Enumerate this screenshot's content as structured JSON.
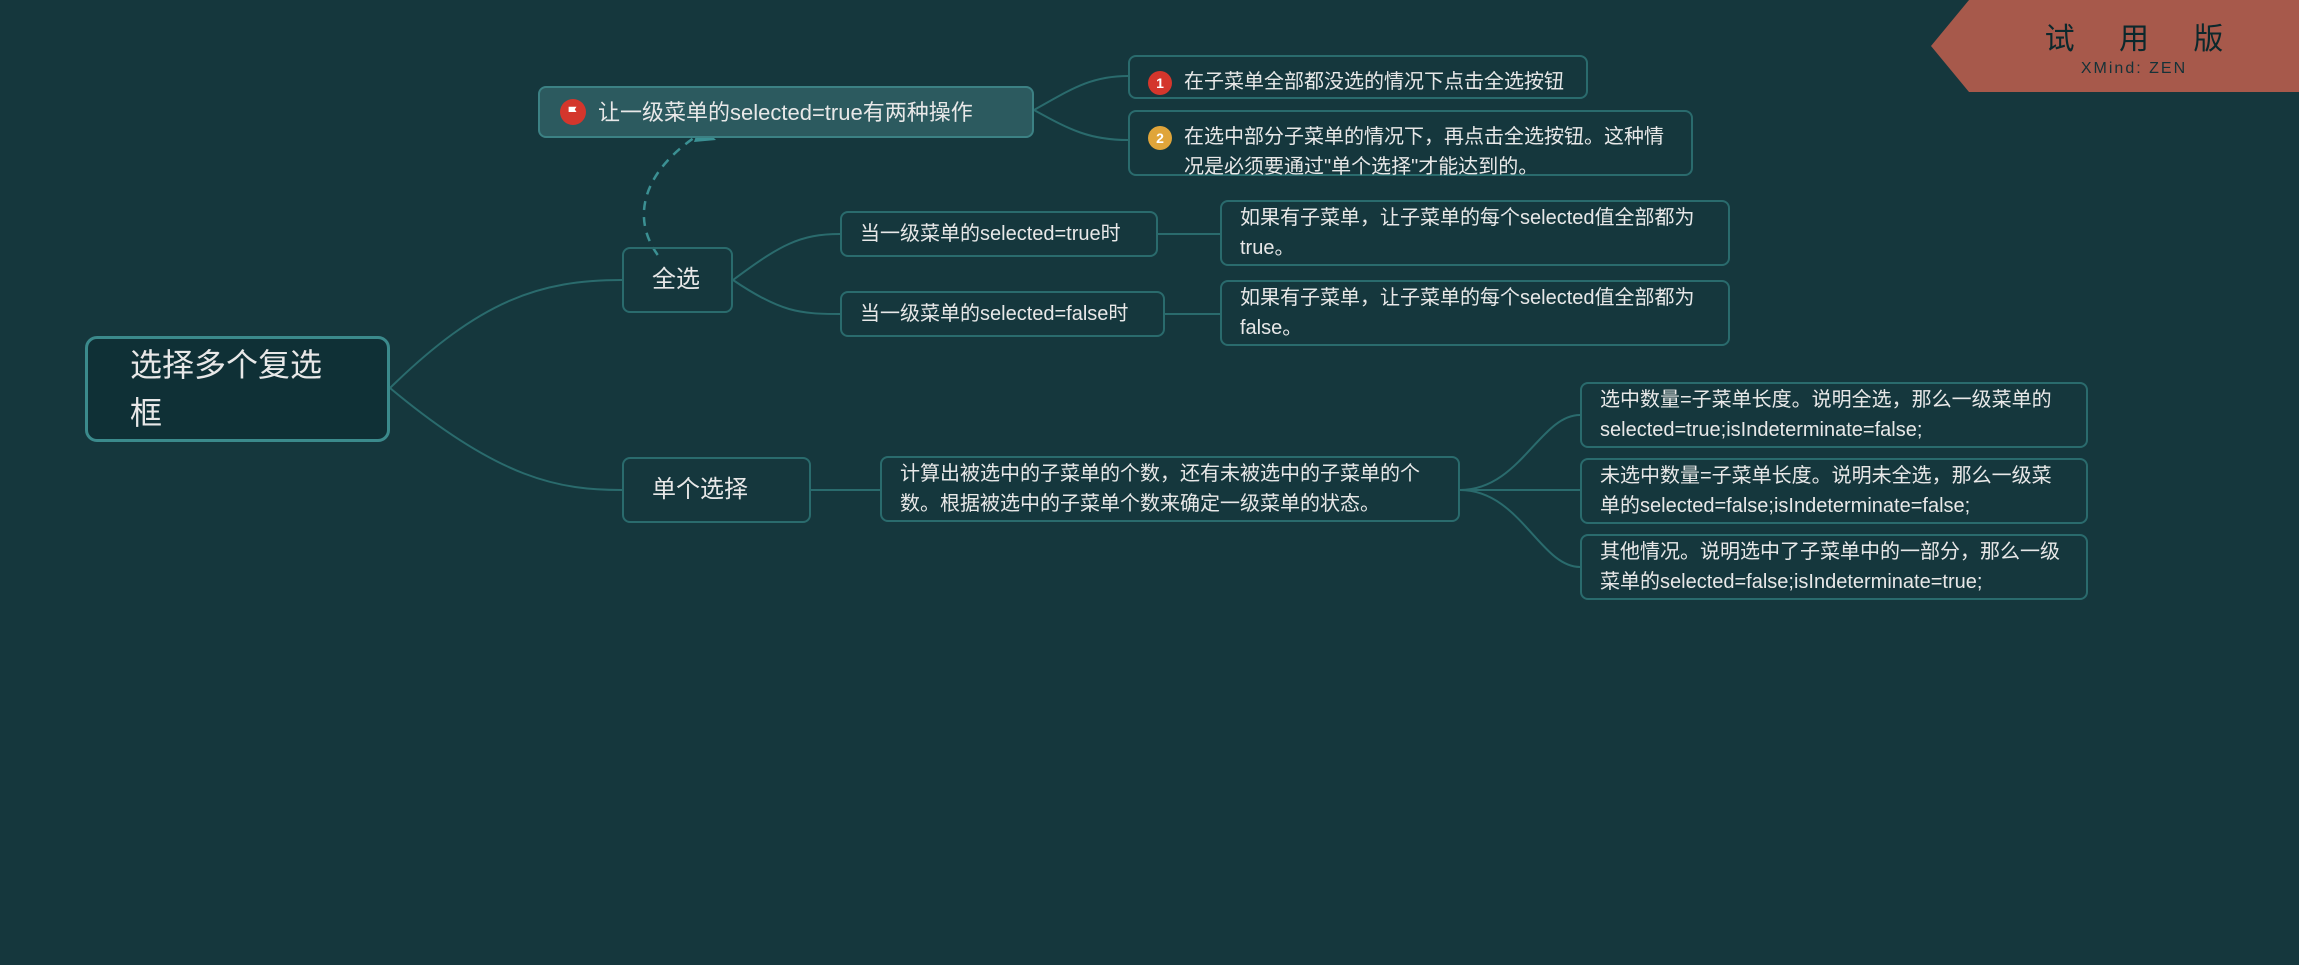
{
  "watermark": {
    "title": "试 用 版",
    "subtitle": "XMind: ZEN"
  },
  "root": "选择多个复选框",
  "floating": "让一级菜单的selected=true有两种操作",
  "floating_children": {
    "opt1": {
      "num": "1",
      "text": "在子菜单全部都没选的情况下点击全选按钮"
    },
    "opt2": {
      "num": "2",
      "text": "在选中部分子菜单的情况下，再点击全选按钮。这种情况是必须要通过\"单个选择\"才能达到的。"
    }
  },
  "l1": {
    "selectAll": "全选",
    "singleSel": "单个选择"
  },
  "selectAll_children": {
    "whenTrue": "当一级菜单的selected=true时",
    "whenTrue_child": "如果有子菜单，让子菜单的每个selected值全部都为true。",
    "whenFalse": "当一级菜单的selected=false时",
    "whenFalse_child": "如果有子菜单，让子菜单的每个selected值全部都为false。"
  },
  "singleSel_child": "计算出被选中的子菜单的个数，还有未被选中的子菜单的个数。根据被选中的子菜单个数来确定一级菜单的状态。",
  "singleSel_cases": {
    "c1": "选中数量=子菜单长度。说明全选，那么一级菜单的selected=true;isIndeterminate=false;",
    "c2": "未选中数量=子菜单长度。说明未全选，那么一级菜单的selected=false;isIndeterminate=false;",
    "c3": "其他情况。说明选中了子菜单中的一部分，那么一级菜单的selected=false;isIndeterminate=true;"
  }
}
